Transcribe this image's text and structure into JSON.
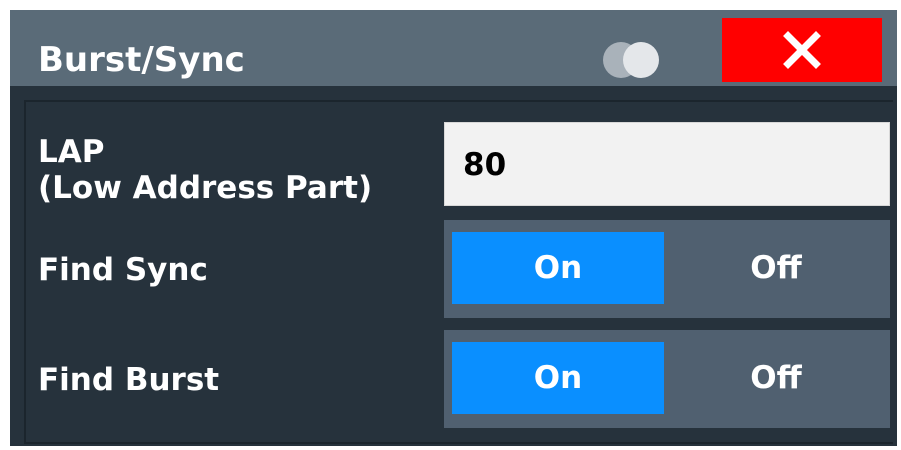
{
  "dialog": {
    "title": "Burst/Sync",
    "close_icon": "close-x-icon",
    "toggle_icon": "overlap-circles-icon"
  },
  "lap": {
    "label_line1": "LAP",
    "label_line2": "(Low Address Part)",
    "value": "80"
  },
  "find_sync": {
    "label": "Find Sync",
    "on_label": "On",
    "off_label": "Off",
    "selected": "On"
  },
  "find_burst": {
    "label": "Find Burst",
    "on_label": "On",
    "off_label": "Off",
    "selected": "On"
  },
  "colors": {
    "titlebar": "#5a6b78",
    "body": "#26323c",
    "close": "#ff0000",
    "selected": "#0a8fff",
    "segment_bg": "#506070"
  }
}
